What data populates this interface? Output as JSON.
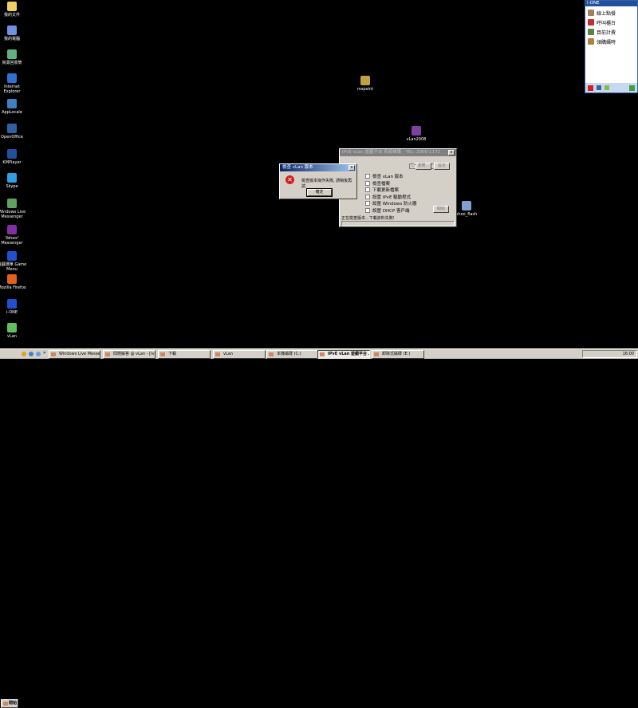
{
  "desktop_icons": [
    {
      "label": "我的文件",
      "color": "#f0d060"
    },
    {
      "label": "我的電腦",
      "color": "#7090e0"
    },
    {
      "label": "資源回收筒",
      "color": "#60b080"
    },
    {
      "label": "Internet Explorer",
      "color": "#3070d0"
    },
    {
      "label": "AppLocale",
      "color": "#4080c0"
    },
    {
      "label": "OpenOffice",
      "color": "#3060a0"
    },
    {
      "label": "KMPlayer",
      "color": "#2050a0"
    },
    {
      "label": "Skype",
      "color": "#30a0e0"
    },
    {
      "label": "Windows Live Messenger",
      "color": "#60a060"
    },
    {
      "label": "Yahoo! Messenger",
      "color": "#8030a0"
    },
    {
      "label": "遊戲選單 Game Menu",
      "color": "#2050d0"
    },
    {
      "label": "Mozilla Firefox",
      "color": "#e06020"
    },
    {
      "label": "i-ONE",
      "color": "#2050d0"
    },
    {
      "label": "vLan",
      "color": "#60c060"
    }
  ],
  "extra_icons": {
    "mspaint": "mspaint",
    "vlan2008": "vLan2008",
    "flash": "shoo_flash"
  },
  "error_dialog": {
    "title": "檢查 vLan 版本",
    "message": "檢查版本操作失敗, 請稍後再試.",
    "ok": "確定",
    "close": "x"
  },
  "main_window": {
    "title": "IPvE vLan 遊戲平台 系統維護 - TEL: 2000-1172",
    "close": "x",
    "path": "C:\\vLan",
    "browse": "瀏覽...",
    "set": "設定",
    "options": [
      "檢查 vLan 版本",
      "檢查檔案",
      "下載更新檔案",
      "設置 IPvE 驅動程式",
      "設置 Windows 防火牆",
      "設置 DHCP 客戶端"
    ],
    "start": "開始",
    "status": "正在檢查版本...下載資料失敗!"
  },
  "panel": {
    "title": "i-ONE",
    "items": [
      "線上點餐",
      "呼叫櫃台",
      "目前計費",
      "領購續時"
    ]
  },
  "taskbar": {
    "start": "開始",
    "chevron": "»",
    "tasks": [
      "Windows Live Messenger",
      "問題解答 @ vLan - [IvE...",
      "下載",
      "vLan",
      "本機磁碟 (C:)",
      "IPvE vLan 遊戲平台 ...",
      "卸除式磁碟 (E:)"
    ],
    "clock": "16:00"
  }
}
